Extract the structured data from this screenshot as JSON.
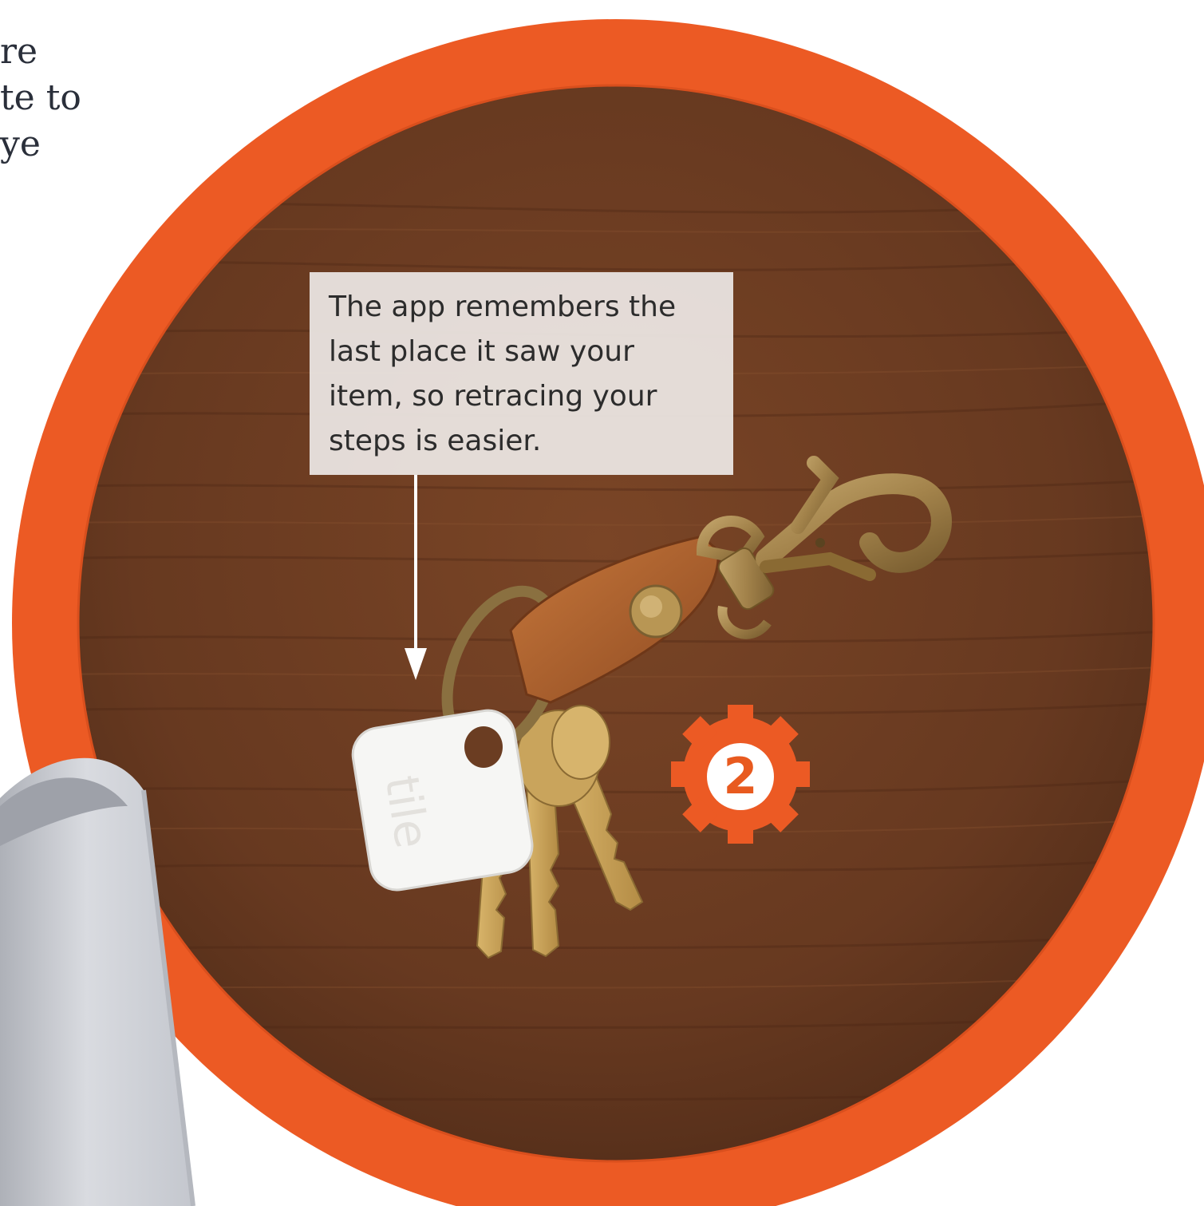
{
  "body_text_fragment": {
    "line_1": "re",
    "line_2": "te to",
    "line_3": "ye"
  },
  "callout": {
    "line_1": "The app remembers the",
    "line_2": "last place it saw your",
    "line_3": "item, so retracing your",
    "line_4": "steps is easier."
  },
  "step_badge": {
    "number": "2",
    "icon": "gear-icon"
  },
  "tracker_tag": {
    "logo_text": "tile"
  },
  "colors": {
    "ring_orange": "#ec5a24",
    "wood_brown": "#6b3d22",
    "callout_background": "#ebe6e2",
    "text_dark": "#2a2f3a"
  }
}
